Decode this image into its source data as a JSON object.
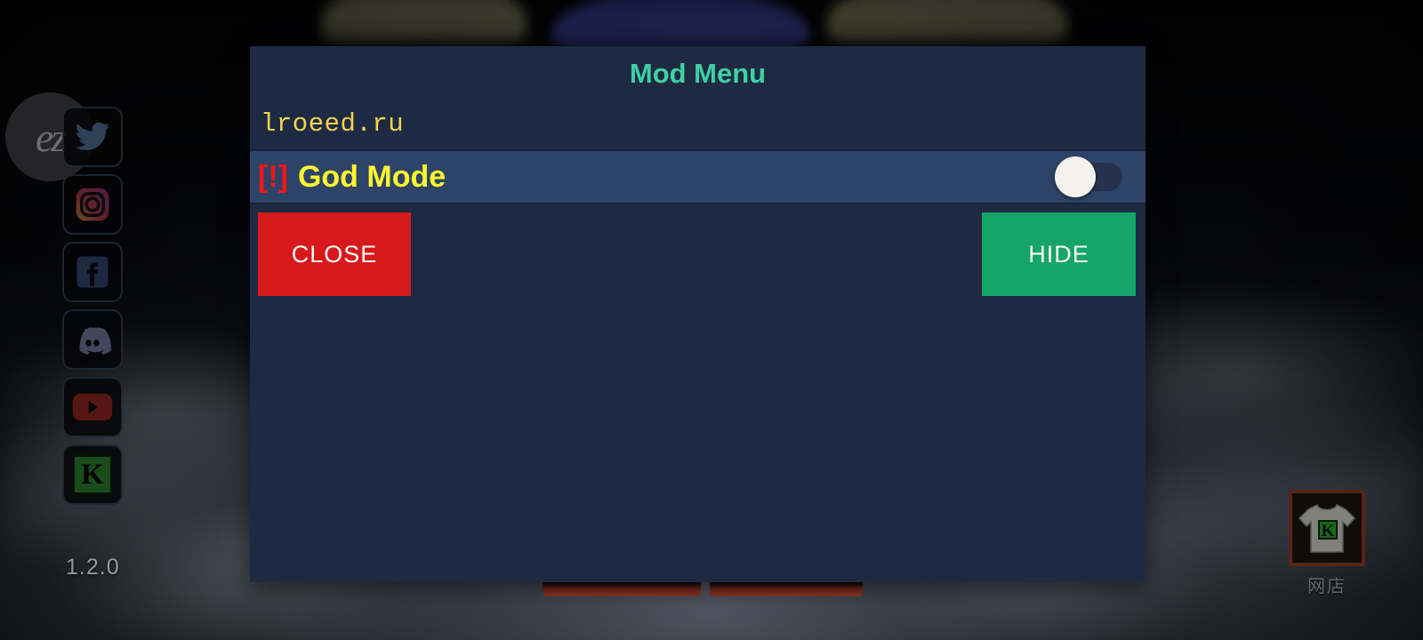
{
  "background": {
    "watermark_text": "ez",
    "version_label": "1.2.0",
    "social_links": [
      {
        "name": "twitter-icon",
        "label": "Twitter"
      },
      {
        "name": "instagram-icon",
        "label": "Instagram"
      },
      {
        "name": "facebook-icon",
        "label": "Facebook"
      },
      {
        "name": "discord-icon",
        "label": "Discord"
      },
      {
        "name": "youtube-icon",
        "label": "YouTube"
      },
      {
        "name": "kick-icon",
        "label": "K"
      }
    ],
    "shop": {
      "icon_letter": "K",
      "label": "网店"
    }
  },
  "dialog": {
    "title": "Mod Menu",
    "url": "lroeed.ru",
    "options": [
      {
        "warning": "[!]",
        "label": "God Mode",
        "toggle_state": "off",
        "toggle_label": "God Mode toggle"
      }
    ],
    "buttons": {
      "close_label": "CLOSE",
      "hide_label": "HIDE"
    }
  },
  "colors": {
    "dialog_bg": "#1e2a42",
    "title_accent": "#3fd0a4",
    "url_text": "#f5d24e",
    "option_row_bg": "#2e4368",
    "option_label": "#fff62e",
    "option_warning": "#f21616",
    "close_button": "#d8191b",
    "hide_button": "#16a566",
    "toggle_thumb": "#f4f2ec",
    "toggle_track": "#26324b"
  }
}
